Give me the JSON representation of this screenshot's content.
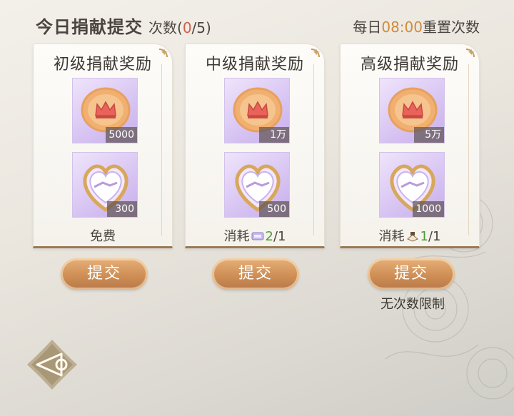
{
  "header": {
    "title": "今日捐献提交",
    "count_prefix": "次数(",
    "count_used": "0",
    "count_sep": "/5)"
  },
  "reset": {
    "prefix": "每日",
    "time": "08:00",
    "suffix": "重置次数"
  },
  "cards": [
    {
      "name": "初级捐献奖励",
      "coin_qty": "5000",
      "heart_qty": "300",
      "cost_text": "免费",
      "cost_cur": "",
      "cost_total": "",
      "button": "提交",
      "note": ""
    },
    {
      "name": "中级捐献奖励",
      "coin_qty": "1万",
      "heart_qty": "500",
      "cost_text": "消耗",
      "cost_cur": "2",
      "cost_total": "/1",
      "button": "提交",
      "note": ""
    },
    {
      "name": "高级捐献奖励",
      "coin_qty": "5万",
      "heart_qty": "1000",
      "cost_text": "消耗",
      "cost_cur": "1",
      "cost_total": "/1",
      "button": "提交",
      "note": "无次数限制"
    }
  ],
  "colors": {
    "accent": "#d08a3a",
    "used": "#d0604a",
    "available": "#4f9a3a",
    "button": "#cf8f55",
    "item_bg": "#d9c6f3"
  },
  "icons": {
    "coin": "crown-coin-icon",
    "heart": "handshake-heart-icon",
    "ticket_mid": "ticket-icon",
    "ticket_high": "book-ticket-icon",
    "back": "back-arrow-icon"
  }
}
